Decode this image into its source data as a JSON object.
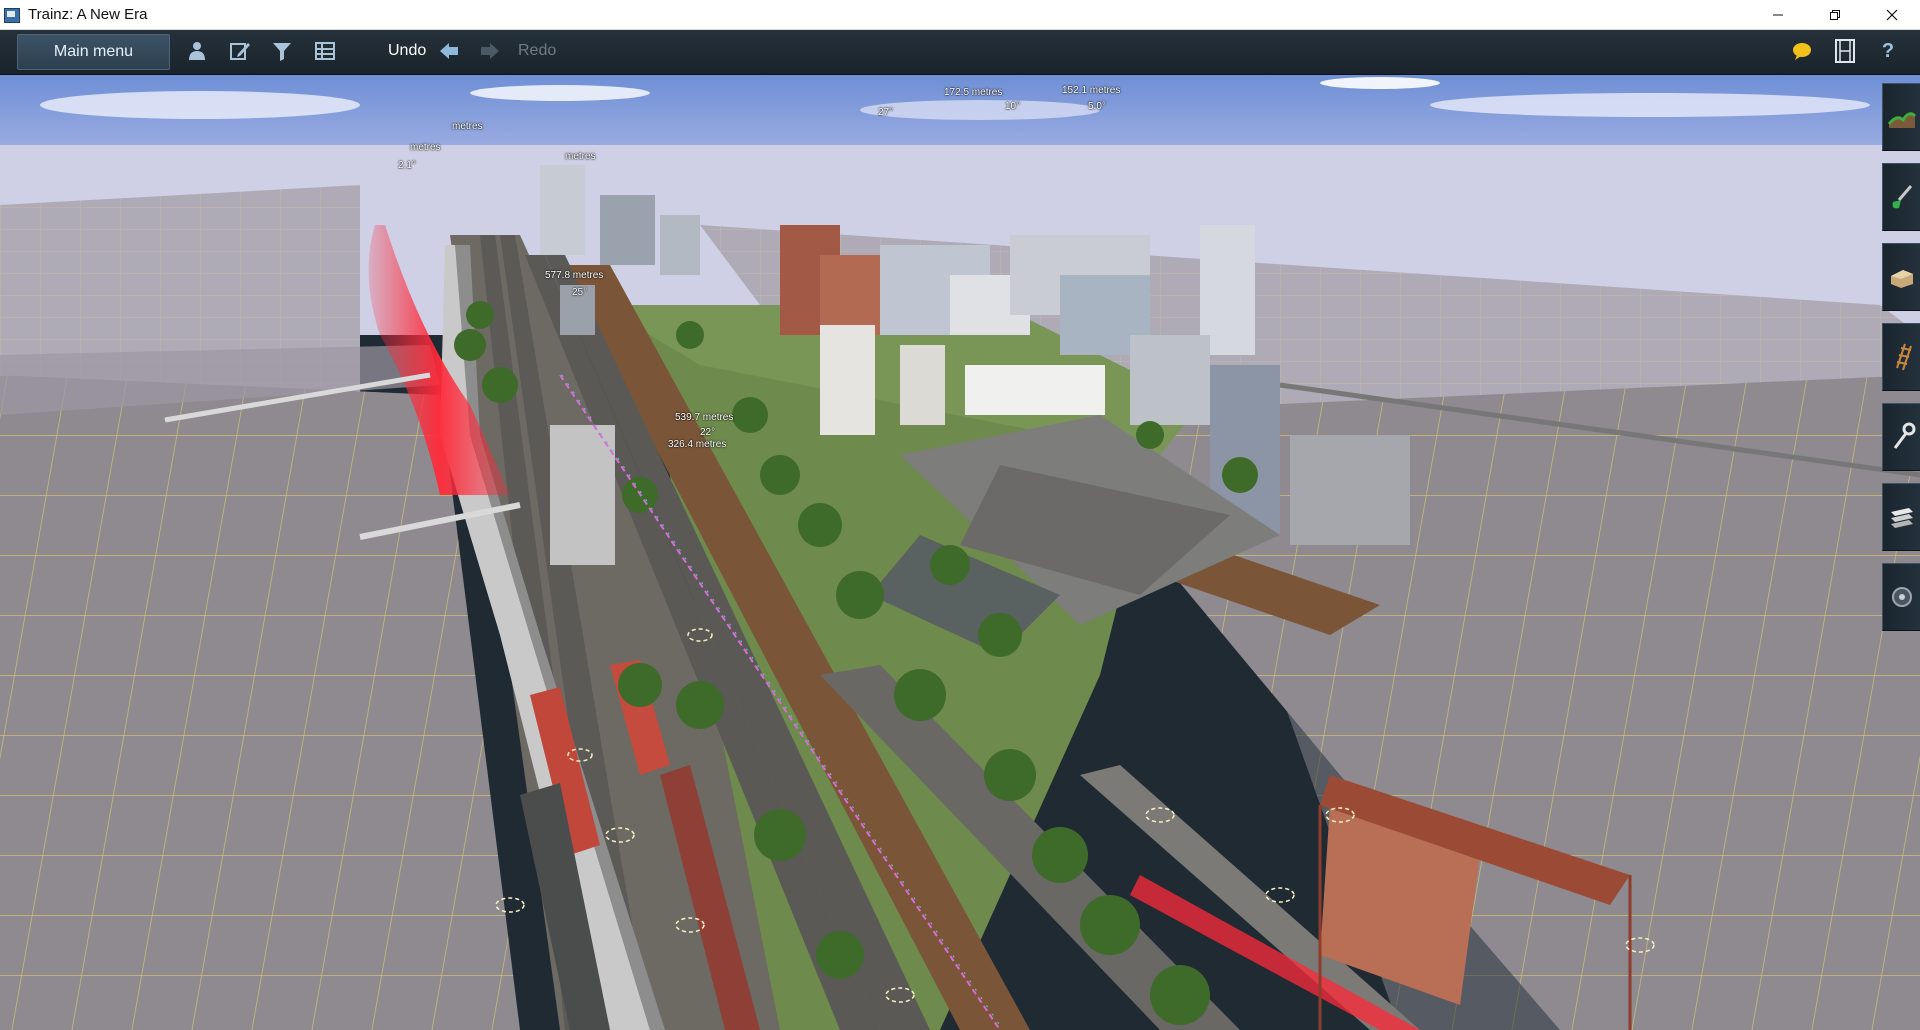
{
  "window": {
    "title": "Trainz: A New Era",
    "controls": [
      "minimize-icon",
      "restore-icon",
      "close-icon"
    ]
  },
  "toolbar": {
    "main_menu_label": "Main menu",
    "icons": [
      "driver-icon",
      "edit-icon",
      "filter-icon",
      "grid-icon"
    ],
    "undo_label": "Undo",
    "redo_label": "Redo",
    "right_icons": [
      "chat-bubble-icon",
      "film-icon",
      "help-icon"
    ],
    "help_label": "?"
  },
  "palette": {
    "tools": [
      "topology-tool-icon",
      "paint-tool-icon",
      "objects-tool-icon",
      "track-tool-icon",
      "wrench-tool-icon",
      "layers-tool-icon",
      "settings-tool-icon"
    ]
  },
  "viewport": {
    "measurements": [
      {
        "label": "577.8 metres"
      },
      {
        "label": "25°"
      },
      {
        "label": "539.7 metres"
      },
      {
        "label": "22°"
      },
      {
        "label": "326.4 metres"
      },
      {
        "label": "152.1 metres"
      },
      {
        "label": "172.5 metres"
      },
      {
        "label": "5.0°"
      },
      {
        "label": "10°"
      },
      {
        "label": "27°"
      },
      {
        "label": "2.1°"
      },
      {
        "label": "metres"
      },
      {
        "label": "metres"
      },
      {
        "label": "metres"
      }
    ]
  },
  "colors": {
    "toolbar_bg": "#1f2a33",
    "sky_top": "#6f8fd6",
    "grid_line": "#e6d36a",
    "highlight_red": "#ff2a3a"
  }
}
